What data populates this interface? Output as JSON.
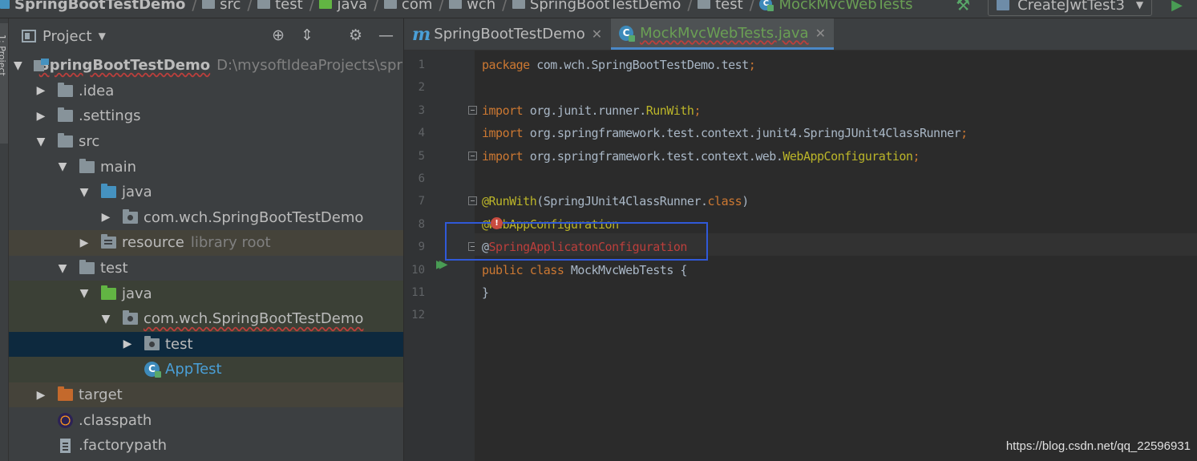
{
  "breadcrumb": {
    "items": [
      "SpringBootTestDemo",
      "src",
      "test",
      "java",
      "com",
      "wch",
      "SpringBootTestDemo",
      "test",
      "MockMvcWebTests"
    ]
  },
  "toolbar": {
    "run_config": "CreateJwtTest3"
  },
  "toolstrip": {
    "project_label": "1: Project"
  },
  "project_panel": {
    "title": "Project",
    "tree": [
      {
        "label": "SpringBootTestDemo",
        "path": "D:\\mysoftIdeaProjects\\spri"
      },
      {
        "label": ".idea"
      },
      {
        "label": ".settings"
      },
      {
        "label": "src"
      },
      {
        "label": "main"
      },
      {
        "label": "java"
      },
      {
        "label": "com.wch.SpringBootTestDemo"
      },
      {
        "label": "resource",
        "hint": "library root"
      },
      {
        "label": "test"
      },
      {
        "label": "java"
      },
      {
        "label": "com.wch.SpringBootTestDemo"
      },
      {
        "label": "test"
      },
      {
        "label": "AppTest"
      },
      {
        "label": "target"
      },
      {
        "label": ".classpath"
      },
      {
        "label": ".factorypath"
      }
    ]
  },
  "editor": {
    "tabs": [
      {
        "label": "SpringBootTestDemo",
        "active": false
      },
      {
        "label": "MockMvcWebTests.java",
        "active": true
      }
    ],
    "lines": [
      {
        "num": "1",
        "tokens": [
          {
            "t": "package ",
            "c": "kw"
          },
          {
            "t": "com.wch.SpringBootTestDemo.test",
            "c": ""
          },
          {
            "t": ";",
            "c": "kw"
          }
        ]
      },
      {
        "num": "2",
        "tokens": []
      },
      {
        "num": "3",
        "tokens": [
          {
            "t": "import ",
            "c": "kw"
          },
          {
            "t": "org.junit.runner.",
            "c": ""
          },
          {
            "t": "RunWith",
            "c": "ann"
          },
          {
            "t": ";",
            "c": "kw"
          }
        ]
      },
      {
        "num": "4",
        "tokens": [
          {
            "t": "import ",
            "c": "kw"
          },
          {
            "t": "org.springframework.test.context.junit4.SpringJUnit4ClassRunner",
            "c": ""
          },
          {
            "t": ";",
            "c": "kw"
          }
        ]
      },
      {
        "num": "5",
        "tokens": [
          {
            "t": "import ",
            "c": "kw"
          },
          {
            "t": "org.springframework.test.context.web.",
            "c": ""
          },
          {
            "t": "WebAppConfiguration",
            "c": "ann"
          },
          {
            "t": ";",
            "c": "kw"
          }
        ]
      },
      {
        "num": "6",
        "tokens": []
      },
      {
        "num": "7",
        "tokens": [
          {
            "t": "@RunWith",
            "c": "ann"
          },
          {
            "t": "(SpringJUnit4ClassRunner.",
            "c": ""
          },
          {
            "t": "class",
            "c": "kw"
          },
          {
            "t": ")",
            "c": ""
          }
        ]
      },
      {
        "num": "8",
        "tokens": [
          {
            "t": "@WebAppConfiguration",
            "c": "ann"
          }
        ]
      },
      {
        "num": "9",
        "tokens": [
          {
            "t": "@",
            "c": ""
          },
          {
            "t": "SpringApplicatonConfiguration",
            "c": "err"
          }
        ]
      },
      {
        "num": "10",
        "tokens": [
          {
            "t": "public class ",
            "c": "kw"
          },
          {
            "t": "MockMvcWebTests {",
            "c": ""
          }
        ]
      },
      {
        "num": "11",
        "tokens": [
          {
            "t": "}",
            "c": ""
          }
        ]
      },
      {
        "num": "12",
        "tokens": []
      }
    ]
  },
  "colors": {
    "keyword": "#cc7832",
    "annotation": "#bbb529",
    "error": "#bc3f3c",
    "highlight_box": "#3059d8"
  },
  "watermark": "https://blog.csdn.net/qq_22596931"
}
